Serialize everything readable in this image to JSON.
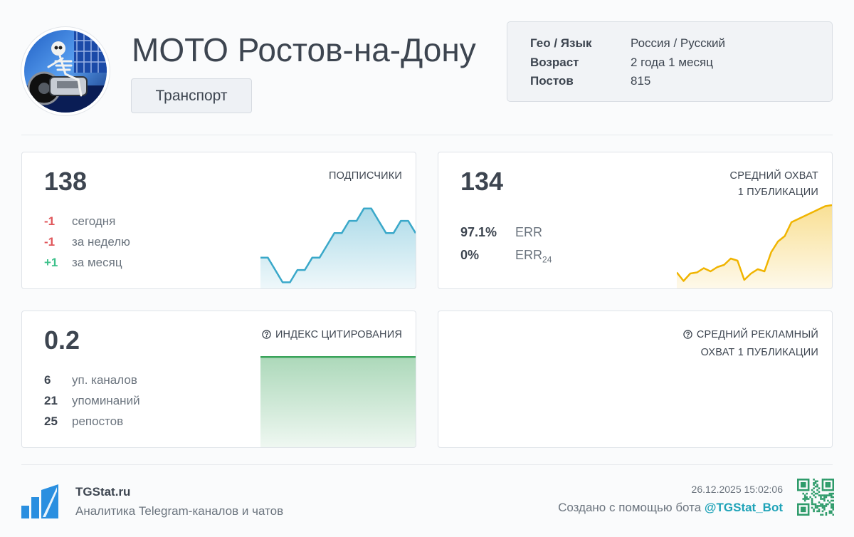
{
  "channel": {
    "title": "МОТО Ростов-на-Дону",
    "category": "Транспорт",
    "info": [
      {
        "key": "Гео / Язык",
        "value": "Россия / Русский"
      },
      {
        "key": "Возраст",
        "value": "2 года 1 месяц"
      },
      {
        "key": "Постов",
        "value": "815"
      }
    ]
  },
  "subscribers": {
    "value": "138",
    "label": "ПОДПИСЧИКИ",
    "changes": [
      {
        "delta": "-1",
        "label": "сегодня"
      },
      {
        "delta": "-1",
        "label": "за неделю"
      },
      {
        "delta": "+1",
        "label": "за месяц"
      }
    ]
  },
  "reach": {
    "value": "134",
    "label_line1": "СРЕДНИЙ ОХВАТ",
    "label_line2": "1 ПУБЛИКАЦИИ",
    "err": {
      "value": "97.1%",
      "label": "ERR"
    },
    "err24": {
      "value": "0%",
      "label": "ERR",
      "sub": "24"
    }
  },
  "citation": {
    "value": "0.2",
    "label": "ИНДЕКС ЦИТИРОВАНИЯ",
    "stats": [
      {
        "num": "6",
        "label": "уп. каналов"
      },
      {
        "num": "21",
        "label": "упоминаний"
      },
      {
        "num": "25",
        "label": "репостов"
      }
    ]
  },
  "ad_reach": {
    "label_line1": "СРЕДНИЙ РЕКЛАМНЫЙ",
    "label_line2": "ОХВАТ 1 ПУБЛИКАЦИИ"
  },
  "footer": {
    "brand": "TGStat.ru",
    "tagline": "Аналитика Telegram-каналов и чатов",
    "date": "26.12.2025 15:02:06",
    "created_by": "Создано с помощью бота ",
    "bot": "@TGStat_Bot"
  },
  "chart_data": [
    {
      "type": "area",
      "name": "subscribers-sparkline",
      "values": [
        134,
        134,
        133,
        132,
        132,
        133,
        133,
        134,
        134,
        135,
        136,
        136,
        137,
        137,
        138,
        138,
        137,
        136,
        136,
        137,
        137,
        136
      ],
      "ylim": [
        131.5,
        138.8
      ],
      "color": "#3aa8c9"
    },
    {
      "type": "area",
      "name": "reach-sparkline",
      "values": [
        63,
        55,
        62,
        63,
        67,
        64,
        68,
        70,
        76,
        74,
        56,
        62,
        66,
        64,
        82,
        92,
        97,
        110,
        113,
        116,
        119,
        122,
        125,
        126
      ],
      "ylim": [
        48,
        132
      ],
      "color": "#f0b400"
    },
    {
      "type": "area",
      "name": "citation-sparkline",
      "values": [
        0.2,
        0.2
      ],
      "ylim": [
        0,
        0.21
      ],
      "color": "#3aa35a"
    }
  ],
  "colors": {
    "negative": "#e0575b",
    "positive": "#3cc08a",
    "accent": "#1fa3b8"
  },
  "icons": [
    "help-circle-icon",
    "tgstat-logo-icon",
    "qr-code-icon"
  ]
}
